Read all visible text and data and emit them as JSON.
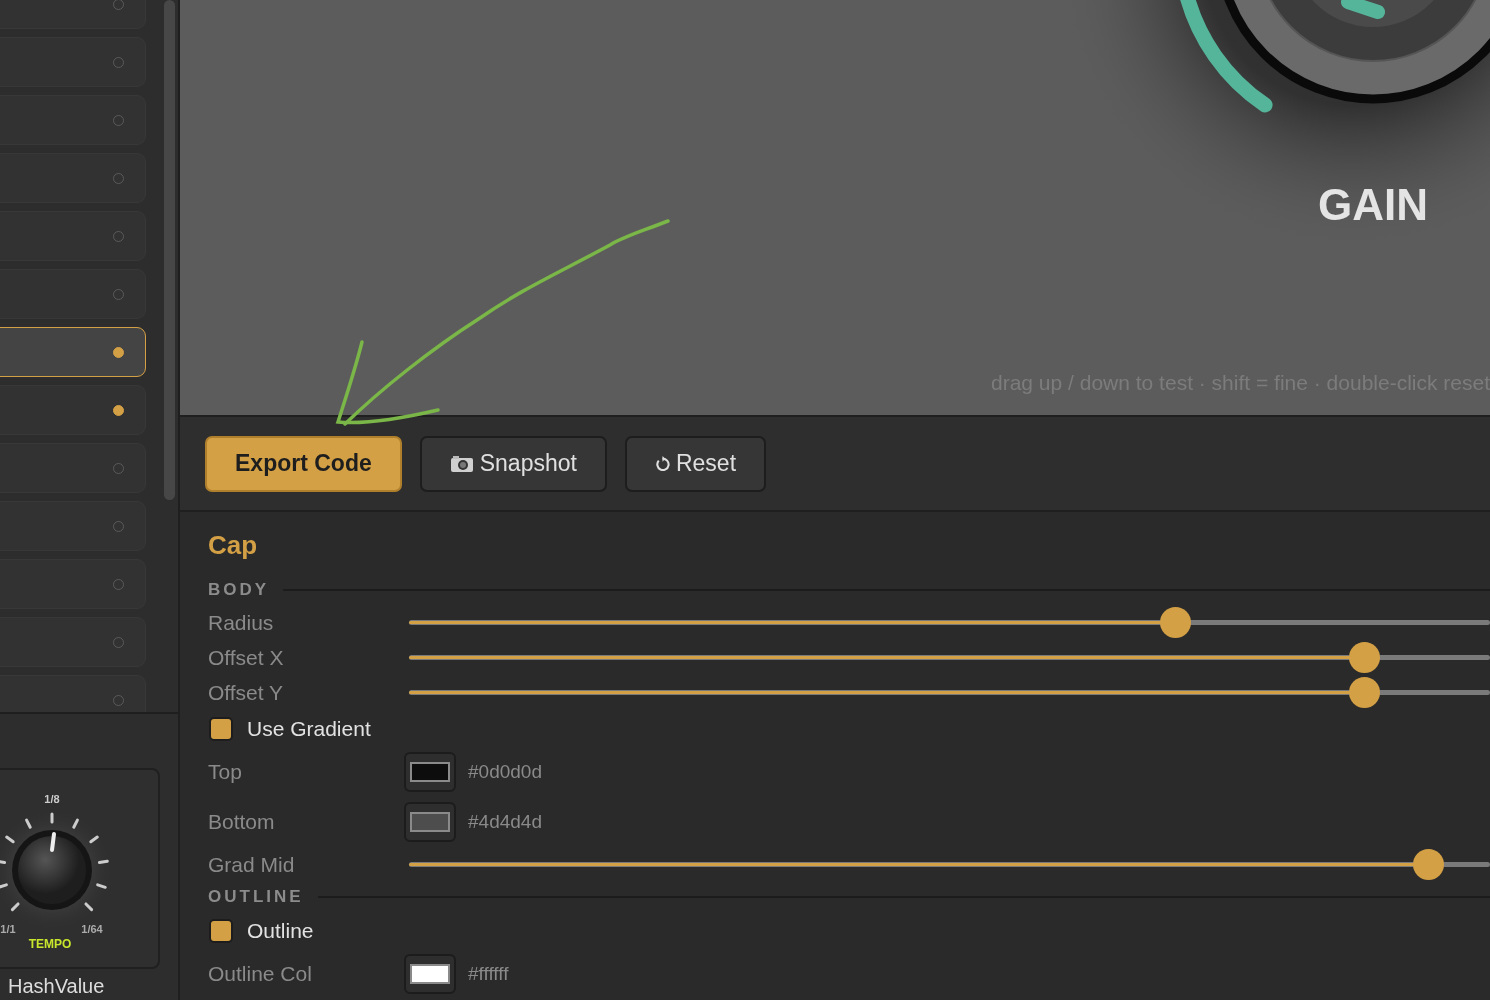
{
  "sidebar": {
    "items": [
      {
        "selected": false,
        "on": false
      },
      {
        "selected": false,
        "on": false
      },
      {
        "selected": false,
        "on": false
      },
      {
        "selected": false,
        "on": false
      },
      {
        "selected": false,
        "on": false
      },
      {
        "selected": false,
        "on": false
      },
      {
        "selected": true,
        "on": true
      },
      {
        "selected": false,
        "on": true
      },
      {
        "selected": false,
        "on": false
      },
      {
        "selected": false,
        "on": false
      },
      {
        "selected": false,
        "on": false
      },
      {
        "selected": false,
        "on": false
      },
      {
        "selected": false,
        "on": false
      }
    ],
    "preset": {
      "top_label": "1/8",
      "left_label": "1/1",
      "right_label": "1/64",
      "knob_name": "TEMPO",
      "label": "HashValue"
    }
  },
  "preview": {
    "knob_label": "GAIN",
    "hint": "drag up / down to test · shift = fine · double-click reset"
  },
  "toolbar": {
    "buttons": [
      {
        "kind": "primary",
        "label": "Export Code"
      },
      {
        "kind": "camera",
        "label": "Snapshot"
      },
      {
        "kind": "reset",
        "label": "Reset"
      }
    ]
  },
  "panel": {
    "title": "Cap",
    "rows": [
      {
        "kind": "section",
        "label": "BODY"
      },
      {
        "kind": "slider",
        "label": "Radius",
        "level": 0.709
      },
      {
        "kind": "slider",
        "label": "Offset X",
        "level": 0.883
      },
      {
        "kind": "slider",
        "label": "Offset Y",
        "level": 0.883
      },
      {
        "kind": "checkbox",
        "label": "Use Gradient",
        "checked": true
      },
      {
        "kind": "color",
        "label": "Top",
        "value": "#0d0d0d"
      },
      {
        "kind": "color",
        "label": "Bottom",
        "value": "#4d4d4d"
      },
      {
        "kind": "slider",
        "label": "Grad Mid",
        "level": 0.943
      },
      {
        "kind": "section",
        "label": "OUTLINE"
      },
      {
        "kind": "checkbox",
        "label": "Outline",
        "checked": true
      },
      {
        "kind": "color",
        "label": "Outline Col",
        "value": "#ffffff"
      }
    ]
  }
}
